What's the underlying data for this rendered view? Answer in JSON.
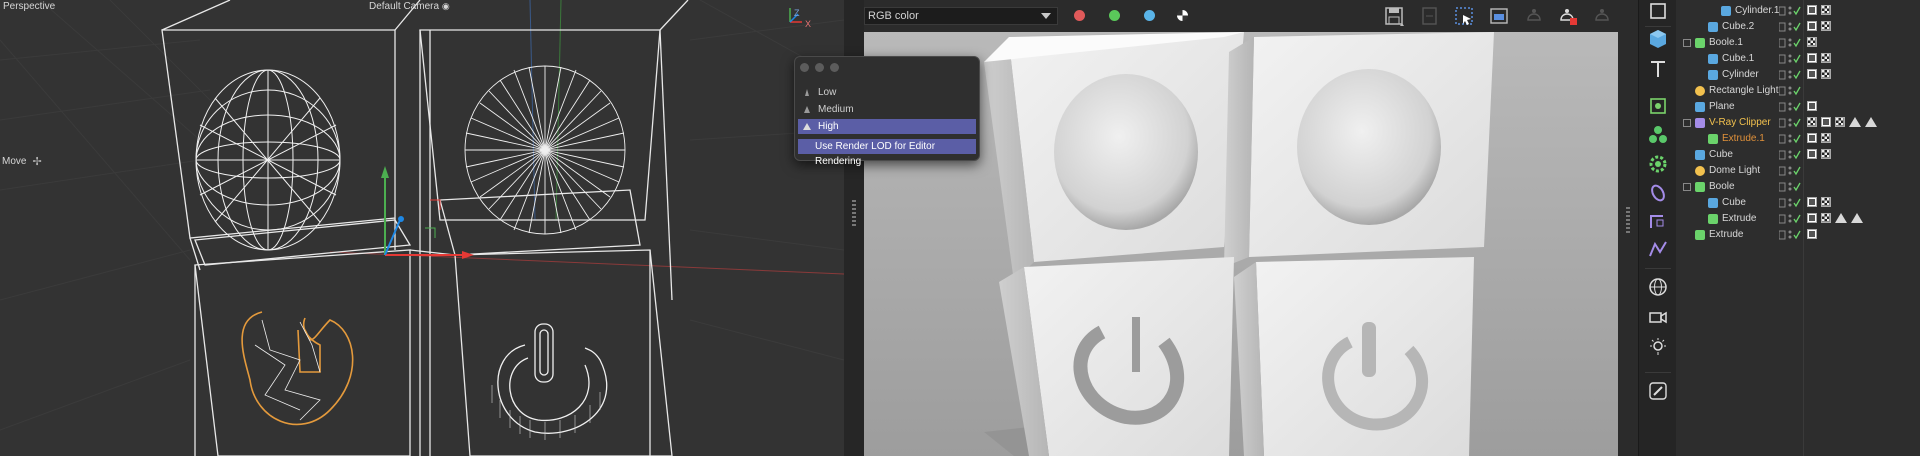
{
  "viewport": {
    "title": "Perspective",
    "camera": "Default Camera",
    "camera_icon": "camera-icon",
    "tool_label": "Move",
    "axis_x": "X",
    "axis_z": "Z"
  },
  "render_view": {
    "channel_select": "RGB color",
    "channel_dots": [
      "#e05a5a",
      "#5ac85a",
      "#5ab4e8"
    ],
    "toolbar_icons": [
      "save-icon",
      "save-new-icon",
      "region-render-icon",
      "interactive-region-icon",
      "ipr-start-icon",
      "ipr-stop-icon",
      "ipr-pause-icon"
    ]
  },
  "lod_popup": {
    "items": [
      {
        "label": "Low",
        "selected": false
      },
      {
        "label": "Medium",
        "selected": false
      },
      {
        "label": "High",
        "selected": true
      },
      {
        "label": "Use Render LOD for Editor Rendering",
        "selected": true
      }
    ]
  },
  "tools": [
    "select-icon",
    "cube-icon",
    "text-icon",
    "generator-icon",
    "cloner-icon",
    "gear-icon",
    "deformer-icon",
    "spline-icon",
    "hypernurbs-icon",
    "globe-icon",
    "camera-icon",
    "light-icon",
    "pen-icon"
  ],
  "objects": [
    {
      "name": "Cylinder.1",
      "depth": 2,
      "icon": "cylinder-icon",
      "style": "normal"
    },
    {
      "name": "Cube.2",
      "depth": 1,
      "icon": "cube-icon",
      "style": "normal"
    },
    {
      "name": "Boole.1",
      "depth": 0,
      "icon": "boole-icon",
      "style": "normal"
    },
    {
      "name": "Cube.1",
      "depth": 1,
      "icon": "cube-icon",
      "style": "normal"
    },
    {
      "name": "Cylinder",
      "depth": 1,
      "icon": "cylinder-icon",
      "style": "normal"
    },
    {
      "name": "Rectangle Light",
      "depth": 0,
      "icon": "light-icon",
      "style": "normal"
    },
    {
      "name": "Plane",
      "depth": 0,
      "icon": "plane-icon",
      "style": "normal"
    },
    {
      "name": "V-Ray Clipper",
      "depth": 0,
      "icon": "clipper-icon",
      "style": "yellow"
    },
    {
      "name": "Extrude.1",
      "depth": 1,
      "icon": "extrude-icon",
      "style": "orange"
    },
    {
      "name": "Cube",
      "depth": 0,
      "icon": "cube-icon",
      "style": "normal"
    },
    {
      "name": "Dome Light",
      "depth": 0,
      "icon": "light-icon",
      "style": "normal"
    },
    {
      "name": "Boole",
      "depth": 0,
      "icon": "boole-icon",
      "style": "normal"
    },
    {
      "name": "Cube",
      "depth": 1,
      "icon": "cube-icon",
      "style": "normal"
    },
    {
      "name": "Extrude",
      "depth": 1,
      "icon": "extrude-icon",
      "style": "normal"
    },
    {
      "name": "Extrude",
      "depth": 0,
      "icon": "extrude-icon",
      "style": "normal"
    }
  ],
  "colors": {
    "selection": "#5b5ea6",
    "active_object": "#f2c14e",
    "selected_object": "#e0913a"
  }
}
